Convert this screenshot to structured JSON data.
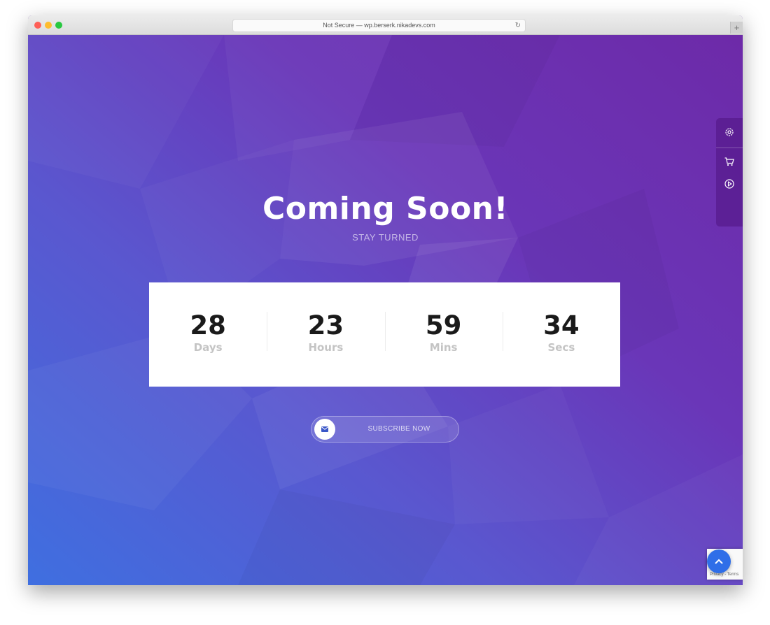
{
  "browser": {
    "url_text": "Not Secure — wp.berserk.nikadevs.com",
    "new_tab_symbol": "+",
    "reload_symbol": "↻"
  },
  "hero": {
    "title": "Coming Soon!",
    "subtitle": "STAY TURNED"
  },
  "countdown": [
    {
      "value": "28",
      "label": "Days"
    },
    {
      "value": "23",
      "label": "Hours"
    },
    {
      "value": "59",
      "label": "Mins"
    },
    {
      "value": "34",
      "label": "Secs"
    }
  ],
  "subscribe": {
    "label": "SUBSCRIBE NOW",
    "icon": "envelope-icon"
  },
  "side_panel": {
    "icons": [
      "gear-icon",
      "cart-icon",
      "play-icon"
    ]
  },
  "recaptcha": {
    "text": "Privacy - Terms"
  },
  "colors": {
    "accent_blue": "#2f6ee8",
    "background_start": "#3f6fe0",
    "background_end": "#6d2aa8"
  }
}
